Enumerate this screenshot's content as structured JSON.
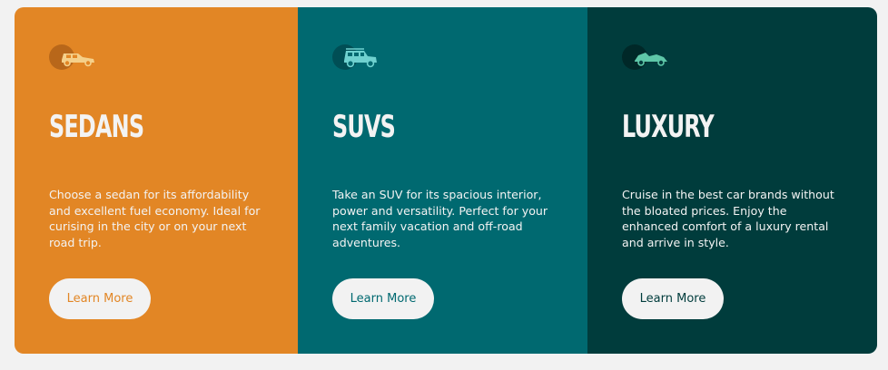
{
  "cards": [
    {
      "id": "sedans",
      "icon": "sedan-car-icon",
      "title": "SEDANS",
      "description": "Choose a sedan for its affordability and excellent fuel economy. Ideal for curising in the city or on your next road trip.",
      "button_label": "Learn More",
      "background_color": "#e28625",
      "icon_color": "#f5d08a"
    },
    {
      "id": "suvs",
      "icon": "suv-car-icon",
      "title": "SUVS",
      "description": "Take an SUV for its spacious interior, power and versatility. Perfect for your next family vacation and off-road adventures.",
      "button_label": "Learn More",
      "background_color": "#006970",
      "icon_color": "#6fd1cf"
    },
    {
      "id": "luxury",
      "icon": "luxury-car-icon",
      "title": "LUXURY",
      "description": "Cruise in the best car brands without the bloated prices. Enjoy the enhanced comfort of a luxury rental and arrive in style.",
      "button_label": "Learn More",
      "background_color": "#003c3c",
      "icon_color": "#5ec7a8"
    }
  ],
  "page_background": "#f2f2f2"
}
